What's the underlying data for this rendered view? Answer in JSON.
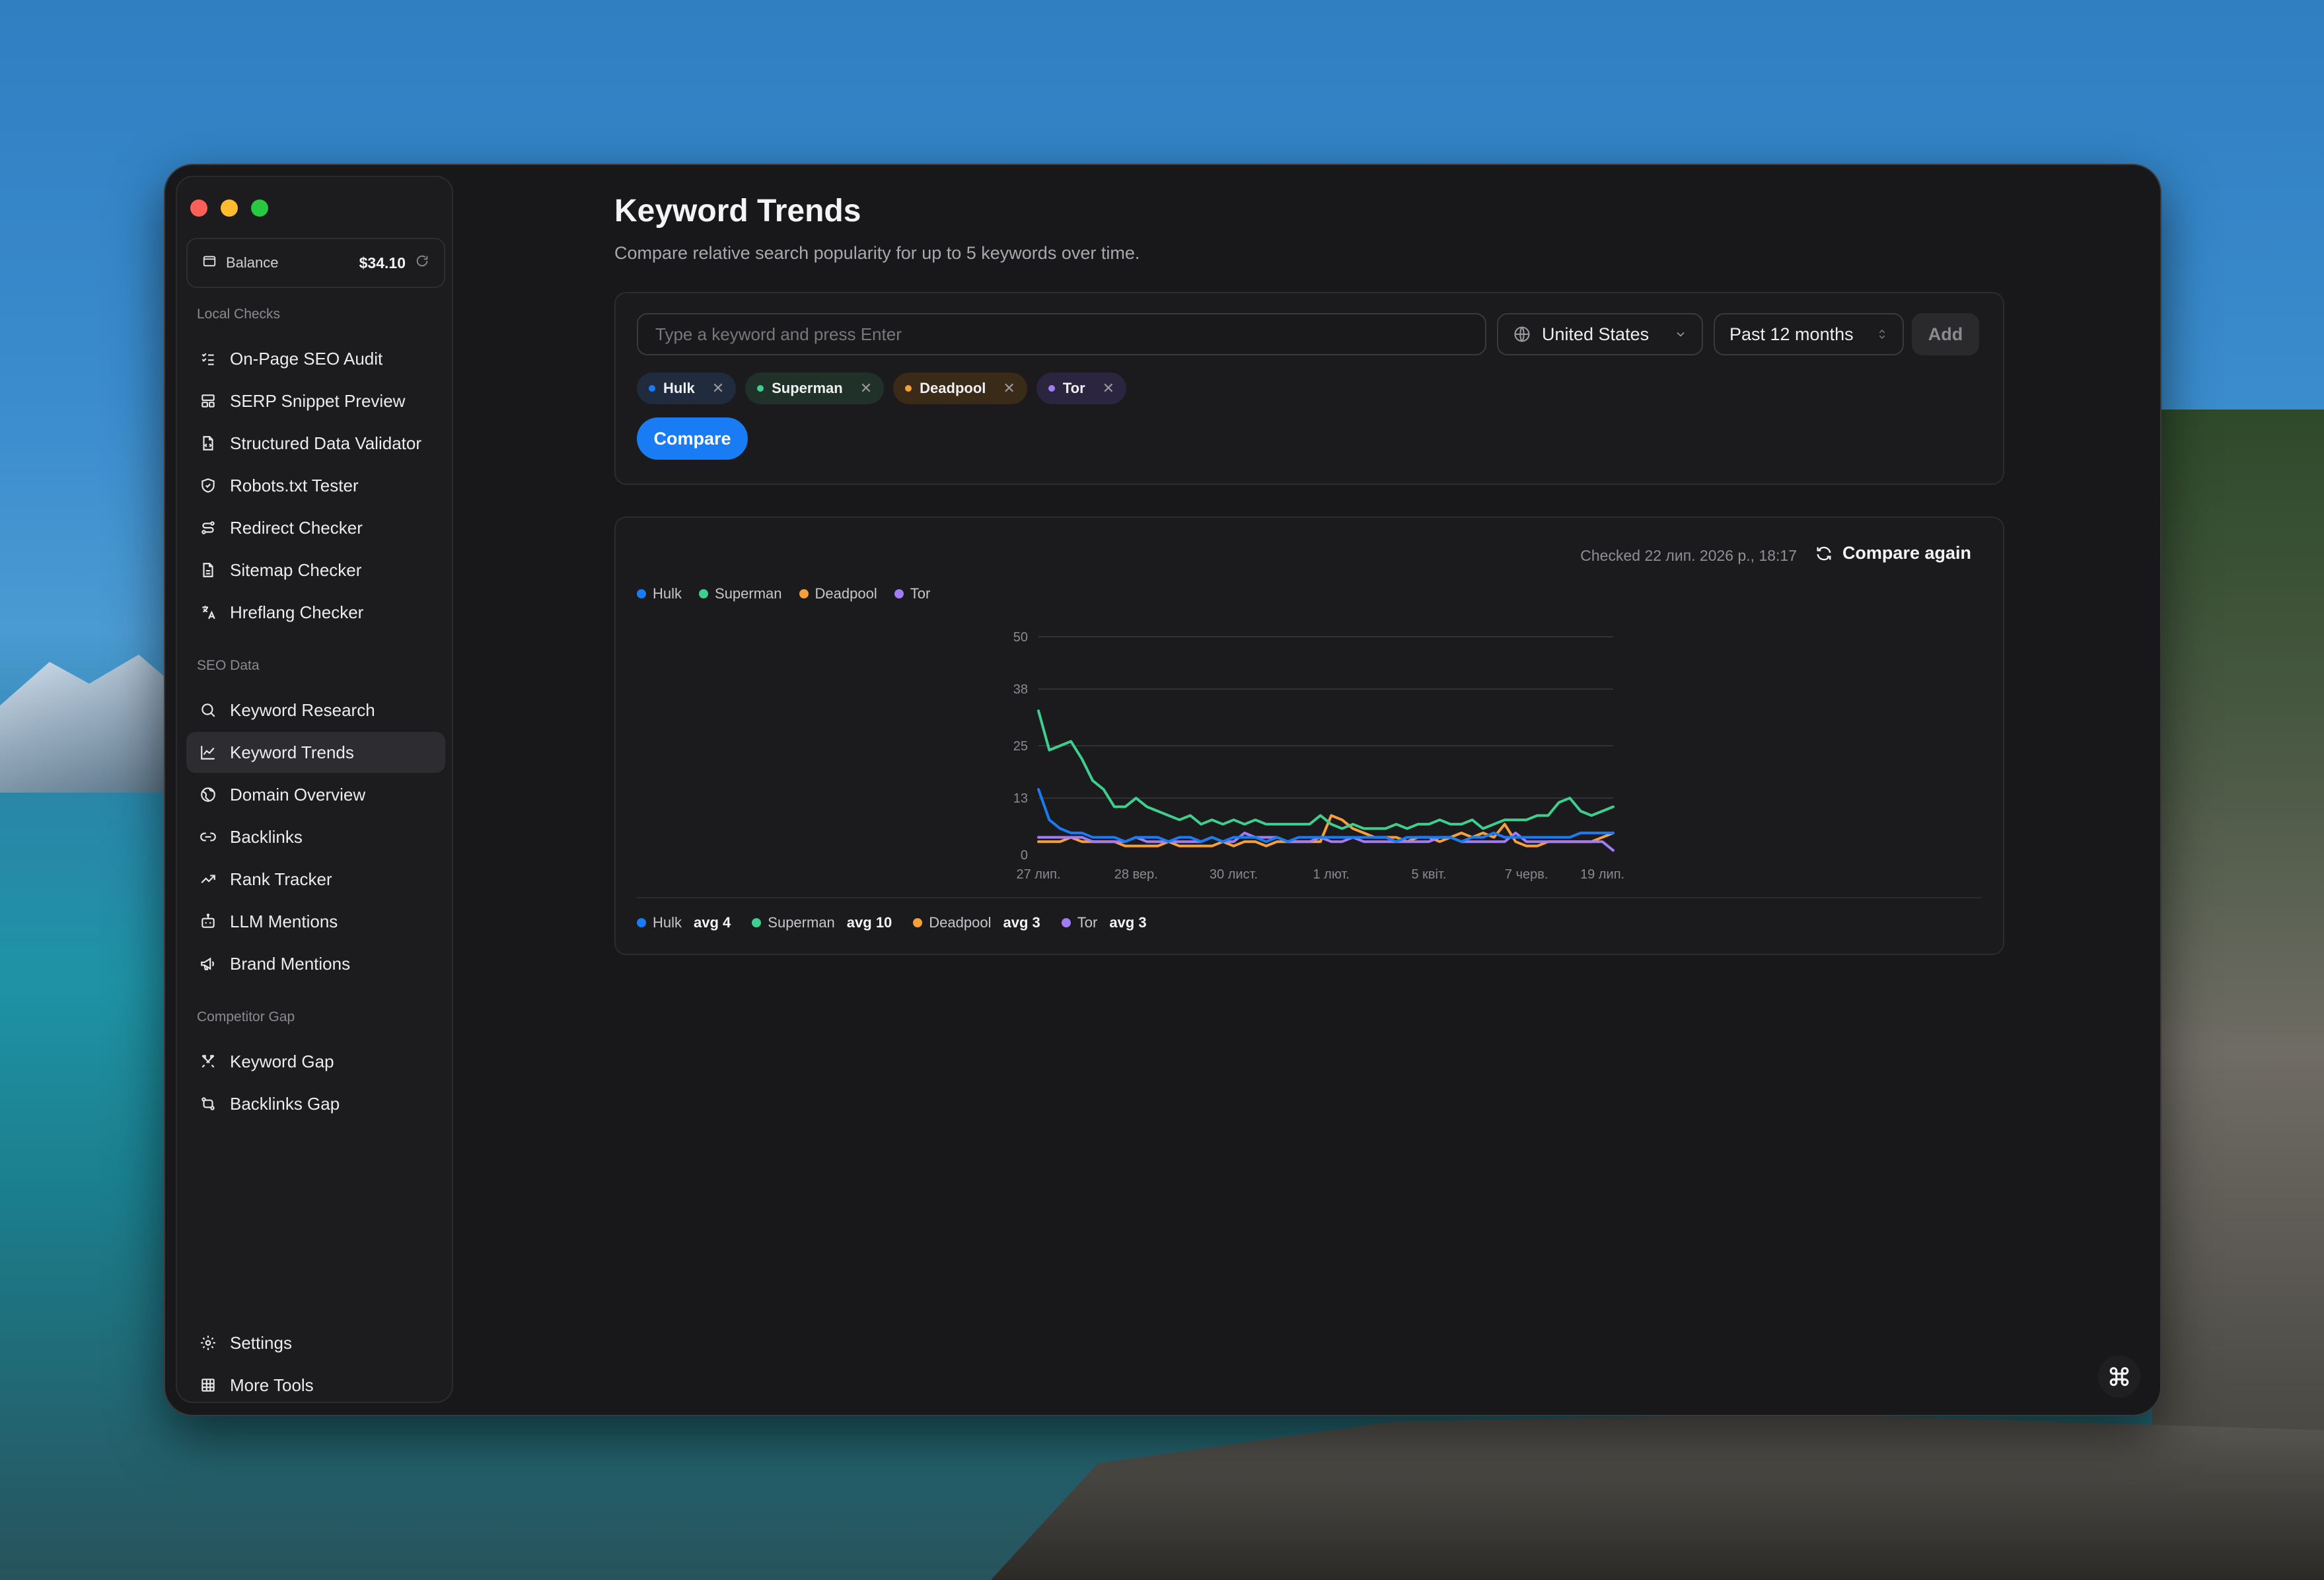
{
  "sidebar": {
    "balance_label": "Balance",
    "balance_amount": "$34.10",
    "sections": [
      {
        "title": "Local Checks",
        "items": [
          "On-Page SEO Audit",
          "SERP Snippet Preview",
          "Structured Data Validator",
          "Robots.txt Tester",
          "Redirect Checker",
          "Sitemap Checker",
          "Hreflang Checker"
        ]
      },
      {
        "title": "SEO Data",
        "items": [
          "Keyword Research",
          "Keyword Trends",
          "Domain Overview",
          "Backlinks",
          "Rank Tracker",
          "LLM Mentions",
          "Brand Mentions"
        ]
      },
      {
        "title": "Competitor Gap",
        "items": [
          "Keyword Gap",
          "Backlinks Gap"
        ]
      }
    ],
    "footer_items": [
      "Settings",
      "More Tools"
    ],
    "active_item": "Keyword Trends"
  },
  "page": {
    "title": "Keyword Trends",
    "subtitle": "Compare relative search popularity for up to 5 keywords over time."
  },
  "form": {
    "input_placeholder": "Type a keyword and press Enter",
    "input_value": "",
    "country": "United States",
    "period": "Past 12 months",
    "add_label": "Add",
    "compare_label": "Compare",
    "chips": [
      {
        "label": "Hulk",
        "color": "#1a7cf5"
      },
      {
        "label": "Superman",
        "color": "#3ecf8e"
      },
      {
        "label": "Deadpool",
        "color": "#f5a03a"
      },
      {
        "label": "Tor",
        "color": "#a27cf5"
      }
    ]
  },
  "results": {
    "checked_text": "Checked 22 лип. 2026 р., 18:17",
    "compare_again_label": "Compare again",
    "summary": [
      {
        "name": "Hulk",
        "avg": "avg 4",
        "color": "#1a7cf5"
      },
      {
        "name": "Superman",
        "avg": "avg 10",
        "color": "#3ecf8e"
      },
      {
        "name": "Deadpool",
        "avg": "avg 3",
        "color": "#f5a03a"
      },
      {
        "name": "Tor",
        "avg": "avg 3",
        "color": "#a27cf5"
      }
    ]
  },
  "chart_data": {
    "type": "line",
    "title": "",
    "xlabel": "",
    "ylabel": "",
    "ylim": [
      0,
      50
    ],
    "y_ticks": [
      0,
      13,
      25,
      38,
      50
    ],
    "x_tick_labels": [
      "27 лип.",
      "28 вер.",
      "30 лист.",
      "1 лют.",
      "5 квіт.",
      "7 черв.",
      "19 лип."
    ],
    "x_tick_positions": [
      0,
      9,
      18,
      27,
      36,
      45,
      52
    ],
    "grid": true,
    "legend": "top-left",
    "n_points": 54,
    "series": [
      {
        "name": "Hulk",
        "color": "#1a7cf5",
        "values": [
          15,
          8,
          6,
          5,
          5,
          4,
          4,
          4,
          3,
          4,
          4,
          4,
          3,
          4,
          4,
          3,
          4,
          3,
          4,
          4,
          4,
          3,
          4,
          3,
          4,
          4,
          4,
          4,
          4,
          4,
          4,
          4,
          4,
          3,
          4,
          4,
          4,
          4,
          4,
          3,
          4,
          4,
          5,
          4,
          4,
          4,
          4,
          4,
          4,
          4,
          5,
          5,
          5,
          5
        ]
      },
      {
        "name": "Superman",
        "color": "#3ecf8e",
        "values": [
          33,
          24,
          25,
          26,
          22,
          17,
          15,
          11,
          11,
          13,
          11,
          10,
          9,
          8,
          9,
          7,
          8,
          7,
          8,
          7,
          8,
          7,
          7,
          7,
          7,
          7,
          9,
          7,
          6,
          7,
          6,
          6,
          6,
          7,
          6,
          7,
          7,
          8,
          7,
          7,
          8,
          6,
          7,
          8,
          8,
          8,
          9,
          9,
          12,
          13,
          10,
          9,
          10,
          11
        ]
      },
      {
        "name": "Deadpool",
        "color": "#f5a03a",
        "values": [
          3,
          3,
          3,
          4,
          3,
          3,
          3,
          3,
          2,
          2,
          2,
          2,
          3,
          2,
          2,
          2,
          2,
          3,
          2,
          3,
          3,
          2,
          3,
          3,
          3,
          3,
          3,
          9,
          8,
          6,
          5,
          4,
          4,
          4,
          3,
          4,
          4,
          3,
          4,
          5,
          4,
          5,
          4,
          7,
          3,
          2,
          2,
          3,
          3,
          3,
          3,
          3,
          4,
          5
        ]
      },
      {
        "name": "Tor",
        "color": "#a27cf5",
        "values": [
          4,
          4,
          4,
          4,
          4,
          3,
          3,
          3,
          3,
          4,
          3,
          3,
          3,
          3,
          3,
          3,
          4,
          3,
          3,
          5,
          4,
          4,
          4,
          3,
          3,
          3,
          4,
          3,
          3,
          4,
          3,
          3,
          3,
          3,
          3,
          3,
          3,
          4,
          4,
          3,
          3,
          3,
          3,
          3,
          5,
          3,
          3,
          3,
          3,
          3,
          3,
          3,
          3,
          1
        ]
      }
    ]
  }
}
